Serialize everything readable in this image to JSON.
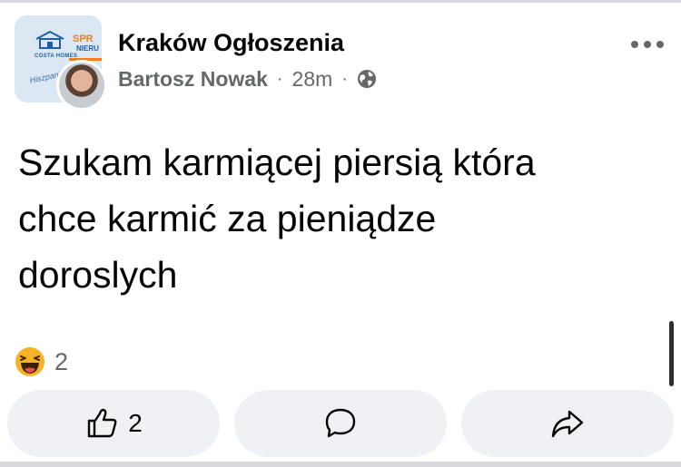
{
  "post": {
    "group_name": "Kraków Ogłoszenia",
    "author": "Bartosz Nowak",
    "time": "28m",
    "separator": "·",
    "text_lines": [
      "Szukam karmiącej piersią która",
      "chce karmić za pieniądze",
      "doroslych"
    ]
  },
  "group_avatar": {
    "text_line1": "SPR",
    "text_line2": "NIERU",
    "brand": "COSTA HOMES",
    "script": "Hiszpania Costa"
  },
  "reactions": {
    "type": "haha",
    "count": "2"
  },
  "actions": {
    "like_count": "2",
    "like_icon": "thumbs-up-icon",
    "comment_icon": "comment-icon",
    "share_icon": "share-icon"
  },
  "colors": {
    "action_bg": "#eff1f4",
    "meta_text": "#65676b",
    "haha_yellow": "#f7b125"
  }
}
